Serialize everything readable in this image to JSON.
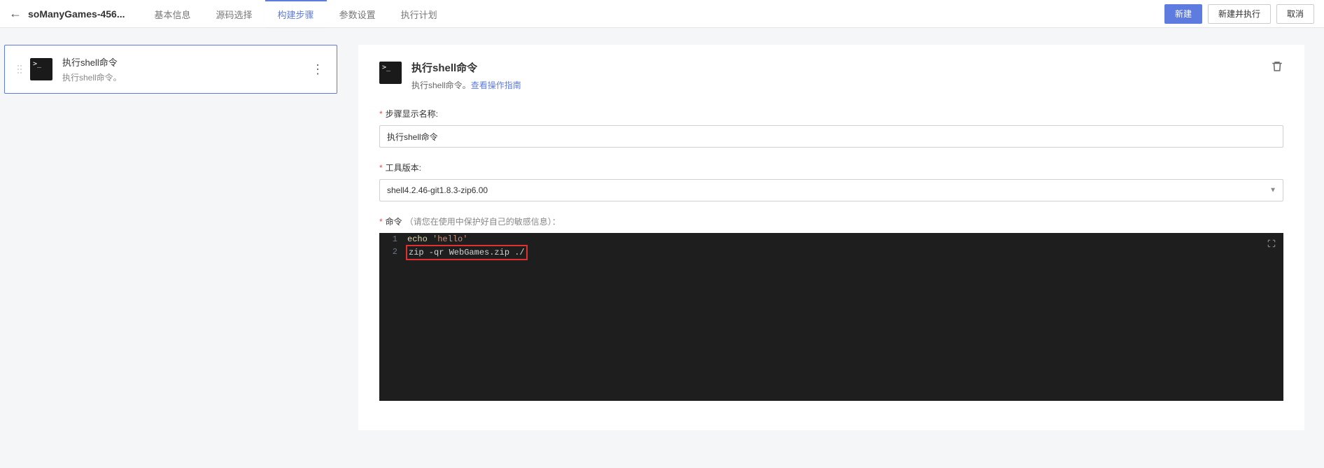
{
  "header": {
    "title": "soManyGames-456...",
    "tabs": [
      "基本信息",
      "源码选择",
      "构建步骤",
      "参数设置",
      "执行计划"
    ],
    "active_tab_index": 2,
    "actions": {
      "create": "新建",
      "create_run": "新建并执行",
      "cancel": "取消"
    }
  },
  "step_list": [
    {
      "title": "执行shell命令",
      "desc": "执行shell命令。"
    }
  ],
  "detail": {
    "title": "执行shell命令",
    "desc_prefix": "执行shell命令。",
    "desc_link": "查看操作指南",
    "fields": {
      "name_label": "步骤显示名称:",
      "name_value": "执行shell命令",
      "tool_label": "工具版本:",
      "tool_value": "shell4.2.46-git1.8.3-zip6.00",
      "command_label": "命令",
      "command_hint": "（请您在使用中保护好自己的敏感信息）："
    },
    "code_lines": [
      {
        "num": "1",
        "tokens": [
          {
            "t": "cmd",
            "v": "echo"
          },
          {
            "t": "plain",
            "v": " "
          },
          {
            "t": "str",
            "v": "'hello'"
          }
        ],
        "hl": false
      },
      {
        "num": "2",
        "tokens": [
          {
            "t": "plain",
            "v": "zip -qr WebGames.zip ./"
          }
        ],
        "hl": true
      }
    ]
  }
}
